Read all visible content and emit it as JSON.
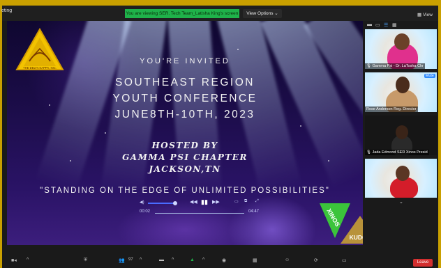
{
  "meeting": {
    "title_partial": "eting",
    "viewing_banner": "You are viewing SER. Tech Team_Latisha King's screen",
    "view_options": "View Options",
    "view_label": "View"
  },
  "slide": {
    "logo_text": "THE DELTA KAPPA, INC.",
    "invited": "YOU'RE INVITED",
    "title_line1": "SOUTHEAST REGION",
    "title_line2": "YOUTH CONFERENCE",
    "title_line3": "JUNE8TH-10TH, 2023",
    "host_line1": "HOSTED BY",
    "host_line2": "GAMMA PSI CHAPTER",
    "host_line3": "JACKSON,TN",
    "slogan": "\"STANDING ON THE EDGE OF UNLIMITED POSSIBILITIES\"",
    "badge_top": "XINOS",
    "badge_bottom": "KUDOS"
  },
  "media_player": {
    "time_current": "00:02",
    "time_total": "04:47"
  },
  "participants": [
    {
      "name": "Gamma Psi - Dr. LaTosha Chr",
      "muted": false
    },
    {
      "name": "Rose Anderson Reg. Director",
      "tag": "Mute",
      "muted": true
    },
    {
      "name": "Jada Edmond SER Xinos Presid",
      "muted": false
    },
    {
      "name": "",
      "muted": false
    }
  ],
  "toolbar": {
    "participants_count": "97",
    "leave_label": "Leave"
  },
  "colors": {
    "frame": "#c9a000",
    "banner_green": "#1fb24a",
    "leave_red": "#d32f2f",
    "logo_yellow": "#f3c300",
    "badge_green": "#3bc43b",
    "badge_gold": "#b8923a"
  }
}
